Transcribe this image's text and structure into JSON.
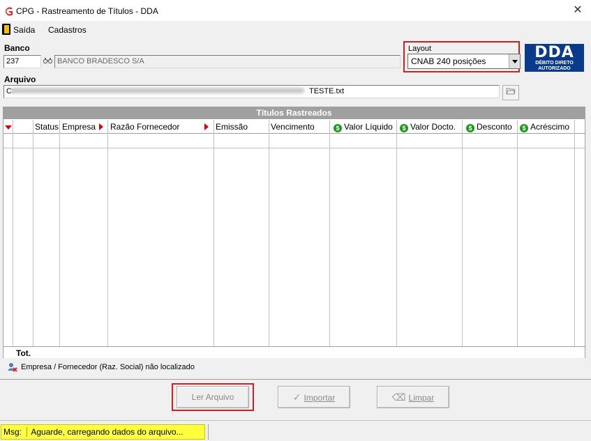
{
  "window": {
    "title": "CPG - Rastreamento de Títulos - DDA",
    "close_glyph": "✕"
  },
  "menu": {
    "items": [
      "Saída",
      "Cadastros"
    ]
  },
  "banco": {
    "label": "Banco",
    "code": "237",
    "name": "BANCO BRADESCO S/A"
  },
  "layout": {
    "label": "Layout",
    "selected": "CNAB 240 posições"
  },
  "dda_logo": {
    "main": "DDA",
    "line1": "DÉBITO DIRETO",
    "line2": "AUTORIZADO"
  },
  "arquivo": {
    "label": "Arquivo",
    "prefix": "C:",
    "suffix": "TESTE.txt"
  },
  "grid": {
    "title": "Títulos Rastreados",
    "columns": [
      "Status",
      "Empresa",
      "Razão Fornecedor",
      "Emissão",
      "Vencimento",
      "Valor Líquido",
      "Valor Docto.",
      "Desconto",
      "Acréscimo"
    ],
    "rows": [],
    "total_label": "Tot."
  },
  "legend": {
    "text": "Empresa / Fornecedor (Raz. Social) não localizado"
  },
  "buttons": {
    "ler_arquivo": "Ler Arquivo",
    "importar": "Importar",
    "limpar": "Limpar"
  },
  "status": {
    "msg_label": "Msg:",
    "message": "Aguarde, carregando dados do arquivo..."
  },
  "colors": {
    "highlight": "#d02020",
    "status_bg": "#ffff3c",
    "dda_blue": "#0a3a8c",
    "grid_title_bg": "#a0a0a0"
  }
}
